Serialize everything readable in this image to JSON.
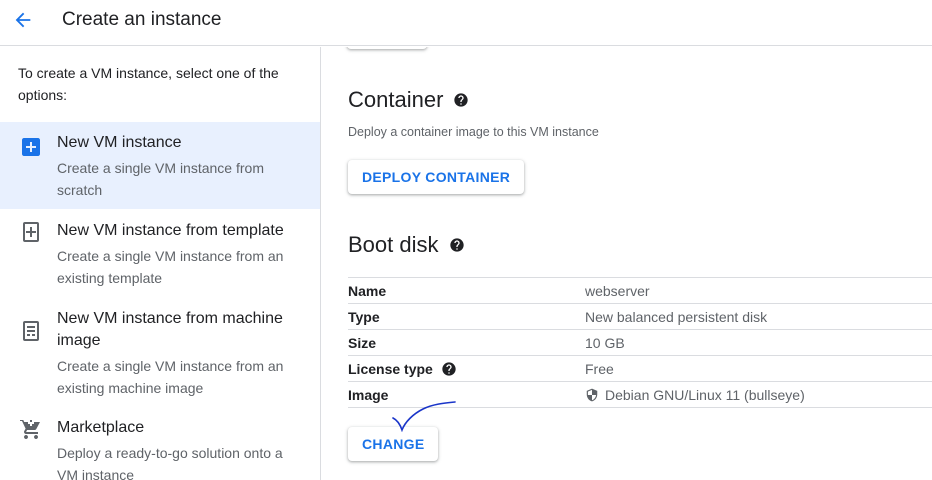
{
  "header": {
    "title": "Create an instance",
    "back_icon": "arrow-back-icon"
  },
  "sidebar": {
    "intro": "To create a VM instance, select one of the options:",
    "options": [
      {
        "title": "New VM instance",
        "description": "Create a single VM instance from scratch",
        "icon": "add-box-icon",
        "selected": true
      },
      {
        "title": "New VM instance from template",
        "description": "Create a single VM instance from an existing template",
        "icon": "template-add-icon",
        "selected": false
      },
      {
        "title": "New VM instance from machine image",
        "description": "Create a single VM instance from an existing machine image",
        "icon": "machine-image-icon",
        "selected": false
      },
      {
        "title": "Marketplace",
        "description": "Deploy a ready-to-go solution onto a VM instance",
        "icon": "cart-icon",
        "selected": false
      }
    ]
  },
  "main": {
    "container": {
      "title": "Container",
      "description": "Deploy a container image to this VM instance",
      "button_label": "DEPLOY CONTAINER"
    },
    "boot_disk": {
      "title": "Boot disk",
      "rows": [
        {
          "key": "Name",
          "value": "webserver"
        },
        {
          "key": "Type",
          "value": "New balanced persistent disk"
        },
        {
          "key": "Size",
          "value": "10 GB"
        },
        {
          "key": "License type",
          "value": "Free"
        },
        {
          "key": "Image",
          "value": "Debian GNU/Linux 11 (bullseye)"
        }
      ],
      "change_button_label": "CHANGE"
    }
  },
  "colors": {
    "accent": "#1a73e8",
    "selected_bg": "#e8f0fe",
    "annotation": "#1a35c9"
  }
}
